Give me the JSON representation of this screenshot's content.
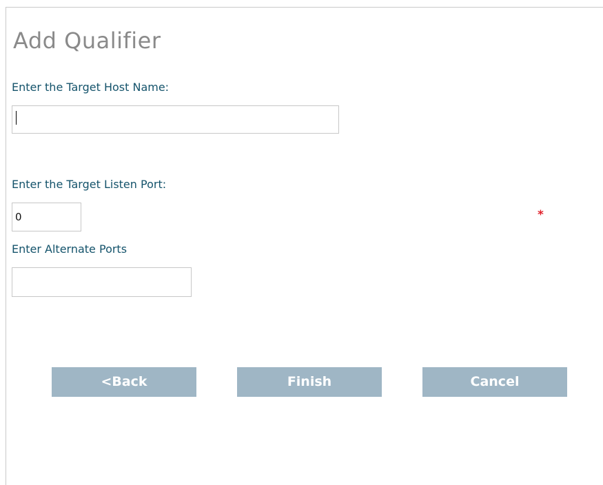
{
  "dialog": {
    "title": "Add Qualifier"
  },
  "fields": {
    "host_name": {
      "label": "Enter the Target Host Name:",
      "value": ""
    },
    "listen_port": {
      "label": "Enter the Target Listen Port:",
      "value": "0",
      "required_marker": "*"
    },
    "alternate_ports": {
      "label": "Enter Alternate Ports",
      "value": ""
    }
  },
  "buttons": {
    "back": "<Back",
    "finish": "Finish",
    "cancel": "Cancel"
  },
  "colors": {
    "title": "#8a8a8a",
    "label": "#14536b",
    "button_bg": "#9fb6c5",
    "button_text": "#ffffff",
    "required": "#e0202a"
  }
}
